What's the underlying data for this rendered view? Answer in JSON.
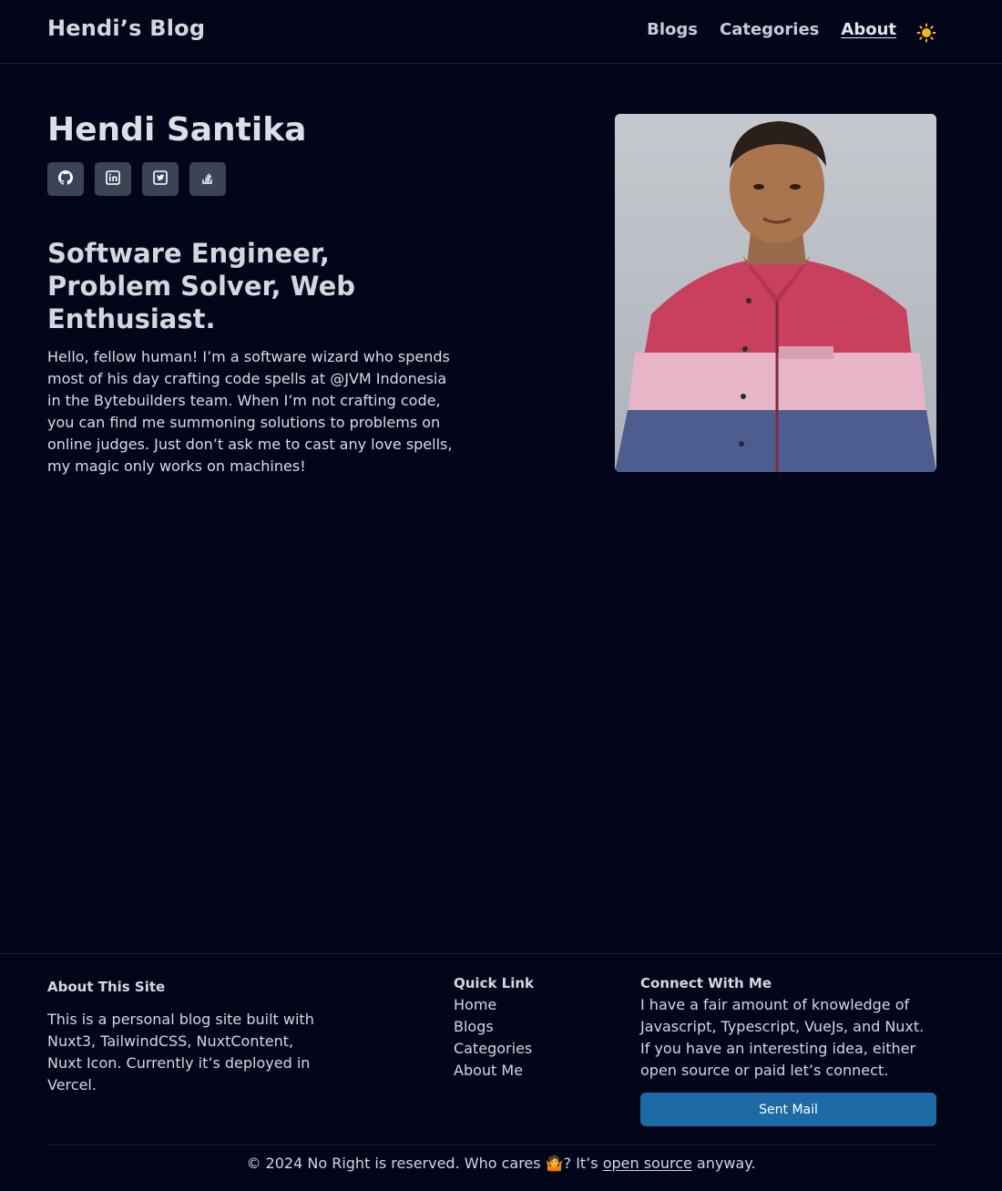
{
  "header": {
    "brand": "Hendi’s Blog",
    "nav": [
      {
        "label": "Blogs"
      },
      {
        "label": "Categories"
      },
      {
        "label": "About"
      }
    ],
    "theme_icon": "sun-icon"
  },
  "profile": {
    "name": "Hendi Santika",
    "socials": [
      {
        "icon": "github-icon"
      },
      {
        "icon": "linkedin-icon"
      },
      {
        "icon": "twitter-icon"
      },
      {
        "icon": "stackoverflow-icon"
      }
    ],
    "tagline": "Software Engineer, Problem Solver, Web Enthusiast.",
    "bio": "Hello, fellow human! I’m a software wizard who spends most of his day crafting code spells at @JVM Indonesia in the Bytebuilders team. When I’m not crafting code, you can find me summoning solutions to problems on online judges. Just don’t ask me to cast any love spells, my magic only works on machines!"
  },
  "footer": {
    "about_title": "About This Site",
    "about_text": "This is a personal blog site built with Nuxt3, TailwindCSS, NuxtContent, Nuxt Icon. Currently it’s deployed in Vercel.",
    "quick_title": "Quick Link",
    "quick_links": [
      "Home",
      "Blogs",
      "Categories",
      "About Me"
    ],
    "connect_title": "Connect With Me",
    "connect_text": "I have a fair amount of knowledge of Javascript, Typescript, VueJs, and Nuxt. If you have an interesting idea, either open source or paid let’s connect.",
    "mail_button": "Sent Mail",
    "copyright_prefix": "© 2024 No Right is reserved. Who cares 🤷? It’s ",
    "copyright_link": "open source",
    "copyright_suffix": " anyway."
  },
  "colors": {
    "background": "#03061a",
    "button": "#1d6aa4",
    "social_bg": "#3a4456"
  }
}
